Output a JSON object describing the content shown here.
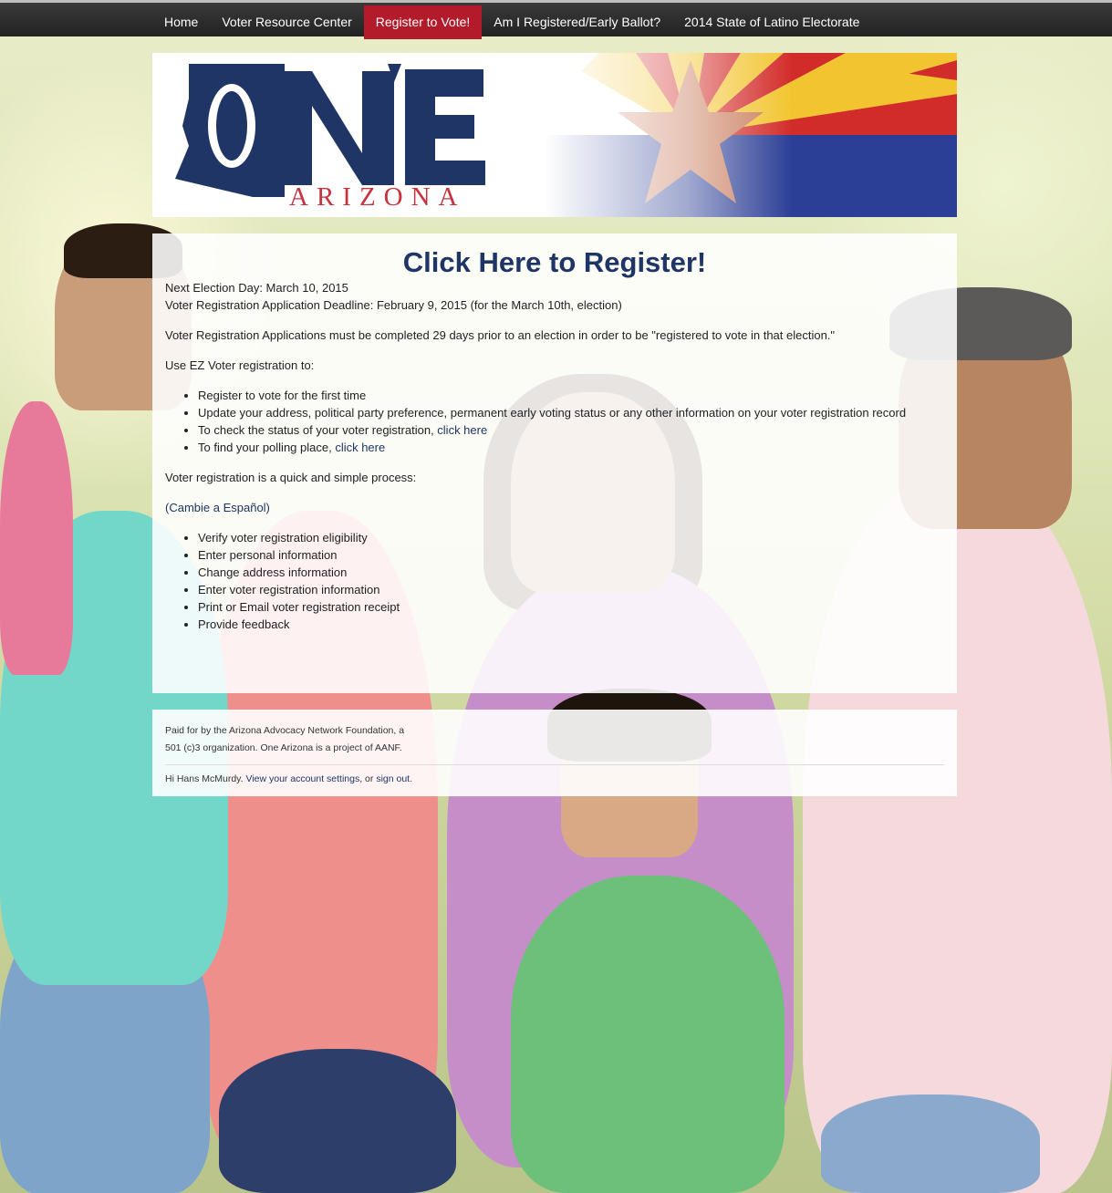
{
  "nav": {
    "items": [
      {
        "label": "Home",
        "active": false
      },
      {
        "label": "Voter Resource Center",
        "active": false
      },
      {
        "label": "Register to Vote!",
        "active": true
      },
      {
        "label": "Am I Registered/Early Ballot?",
        "active": false
      },
      {
        "label": "2014 State of Latino Electorate",
        "active": false
      }
    ]
  },
  "banner": {
    "logo_text": "ONE",
    "logo_subtext": "ARIZONA"
  },
  "colors": {
    "brand_navy": "#1f3566",
    "brand_red": "#b31b2a",
    "flag_red": "#d22c2a",
    "flag_yellow": "#f2c530",
    "flag_blue": "#2c3f96",
    "flag_copper": "#c97c5d"
  },
  "main": {
    "title": "Click Here to Register!",
    "next_election": "Next Election Day: March 10, 2015",
    "deadline": "Voter Registration Application Deadline: February 9, 2015 (for the March 10th, election)",
    "requirement": "Voter Registration Applications must be completed 29 days prior to an election in order to be \"registered to vote in that election.\"",
    "ez_intro": "Use EZ Voter registration to:",
    "ez_items": [
      {
        "text": "Register to vote for the first time",
        "link": ""
      },
      {
        "text": "Update your address, political party preference, permanent early voting status or any other information on your voter registration record",
        "link": ""
      },
      {
        "text": "To check the status of your voter registration, ",
        "link": "click here"
      },
      {
        "text": "To find your polling place, ",
        "link": "click here"
      }
    ],
    "process_intro": "Voter registration is a quick and simple process:",
    "spanish_link": "(Cambie a Español)",
    "process_items": [
      "Verify voter registration eligibility",
      "Enter personal information",
      "Change address information",
      "Enter voter registration information",
      "Print or Email voter registration receipt",
      "Provide feedback"
    ]
  },
  "footer": {
    "paid_line1": "Paid for by the Arizona Advocacy Network Foundation, a",
    "paid_line2": "501 (c)3 organization. One Arizona is a project of AANF.",
    "greeting": "Hi Hans McMurdy. ",
    "account_link": "View your account settings",
    "or_text": ", or ",
    "signout_link": "sign out",
    "period": "."
  }
}
